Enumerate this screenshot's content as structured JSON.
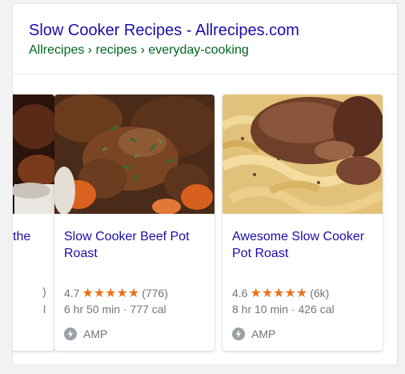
{
  "result": {
    "title": "Slow Cooker Recipes - Allrecipes.com",
    "breadcrumb": "Allrecipes › recipes › everyday-cooking"
  },
  "cards": [
    {
      "title": "the",
      "rating_fragment": ")",
      "meta_fragment": "l"
    },
    {
      "title": "Slow Cooker Beef Pot Roast",
      "rating": "4.7",
      "stars": "★★★★★",
      "reviews": "(776)",
      "meta": "6 hr 50 min · 777 cal",
      "amp": "AMP"
    },
    {
      "title": "Awesome Slow Cooker Pot Roast",
      "rating": "4.6",
      "stars": "★★★★★",
      "reviews": "(6k)",
      "meta": "8 hr 10 min · 426 cal",
      "amp": "AMP"
    }
  ],
  "colors": {
    "title": "#1a0dab",
    "breadcrumb": "#006621",
    "stars": "#e7711b",
    "meta": "#70757a"
  },
  "icons": [
    "amp-bolt-icon",
    "star-icon"
  ]
}
